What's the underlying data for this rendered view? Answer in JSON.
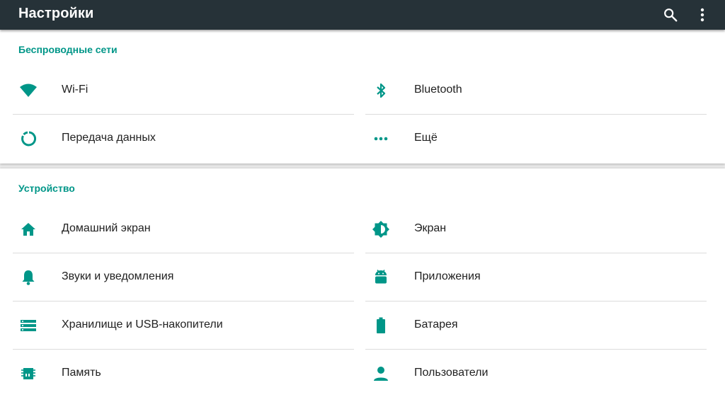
{
  "toolbar": {
    "title": "Настройки",
    "search_icon": "search-icon",
    "overflow_icon": "more-vert-icon"
  },
  "colors": {
    "appbar": "#263238",
    "accent": "#009688",
    "text": "#212121"
  },
  "sections": [
    {
      "title": "Беспроводные сети",
      "items": [
        {
          "label": "Wi-Fi",
          "icon": "wifi-icon"
        },
        {
          "label": "Bluetooth",
          "icon": "bluetooth-icon"
        },
        {
          "label": "Передача данных",
          "icon": "data-usage-icon"
        },
        {
          "label": "Ещё",
          "icon": "more-horiz-icon"
        }
      ]
    },
    {
      "title": "Устройство",
      "items": [
        {
          "label": "Домашний экран",
          "icon": "home-icon"
        },
        {
          "label": "Экран",
          "icon": "brightness-icon"
        },
        {
          "label": "Звуки и уведомления",
          "icon": "bell-icon"
        },
        {
          "label": "Приложения",
          "icon": "android-icon"
        },
        {
          "label": "Хранилище и USB-накопители",
          "icon": "storage-icon"
        },
        {
          "label": "Батарея",
          "icon": "battery-icon"
        },
        {
          "label": "Память",
          "icon": "memory-icon"
        },
        {
          "label": "Пользователи",
          "icon": "person-icon"
        }
      ]
    }
  ]
}
